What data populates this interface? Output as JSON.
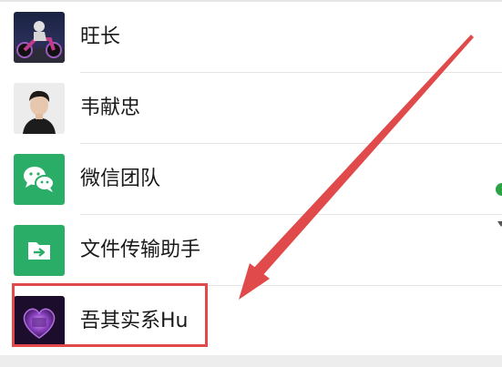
{
  "contacts": [
    {
      "name": "旺长",
      "avatar_icon": "motorcycle-rider-photo"
    },
    {
      "name": "韦献忠",
      "avatar_icon": "man-portrait-photo"
    },
    {
      "name": "微信团队",
      "avatar_icon": "wechat-logo-icon",
      "avatar_color": "#2aae67"
    },
    {
      "name": "文件传输助手",
      "avatar_icon": "file-transfer-icon",
      "avatar_color": "#2aae67"
    },
    {
      "name": "吾其实系Hu",
      "avatar_icon": "purple-heart-photo"
    }
  ],
  "annotation": {
    "color": "#e04a4a",
    "target": "吾其实系Hu"
  },
  "colors": {
    "wechat_green": "#2aae67",
    "status_dot": "#2ba245"
  }
}
